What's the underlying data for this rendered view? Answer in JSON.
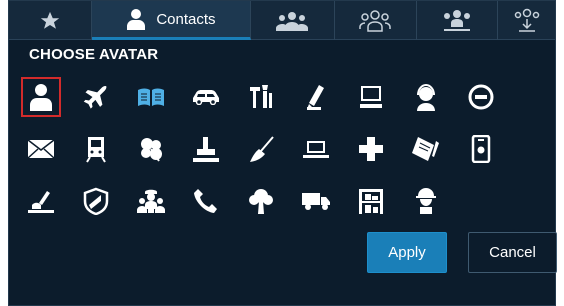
{
  "tabs": [
    {
      "icon": "star-icon",
      "label": ""
    },
    {
      "icon": "person-icon",
      "label": "Contacts"
    },
    {
      "icon": "group-icon",
      "label": ""
    },
    {
      "icon": "group-outline-icon",
      "label": ""
    },
    {
      "icon": "group-chart-icon",
      "label": ""
    },
    {
      "icon": "group-download-icon",
      "label": ""
    }
  ],
  "active_tab": "Contacts",
  "heading": "CHOOSE AVATAR",
  "avatars": [
    "person-icon",
    "airplane-icon",
    "book-icon",
    "car-icon",
    "tools-icon",
    "pencil-ruler-icon",
    "computer-icon",
    "headset-icon",
    "disc-icon",
    "envelope-icon",
    "train-icon",
    "clover-icon",
    "stamp-icon",
    "broom-icon",
    "laptop-icon",
    "cross-icon",
    "notebook-icon",
    "phone-device-icon",
    "gavel-icon",
    "shield-icon",
    "worker-group-icon",
    "telephone-icon",
    "tree-icon",
    "truck-icon",
    "shelves-icon",
    "hard-hat-worker-icon"
  ],
  "selected_avatar": "person-icon",
  "buttons": {
    "apply": "Apply",
    "cancel": "Cancel"
  },
  "colors": {
    "background": "#0c1c2c",
    "accent": "#1a7fb8",
    "selection": "#d32b2b"
  }
}
